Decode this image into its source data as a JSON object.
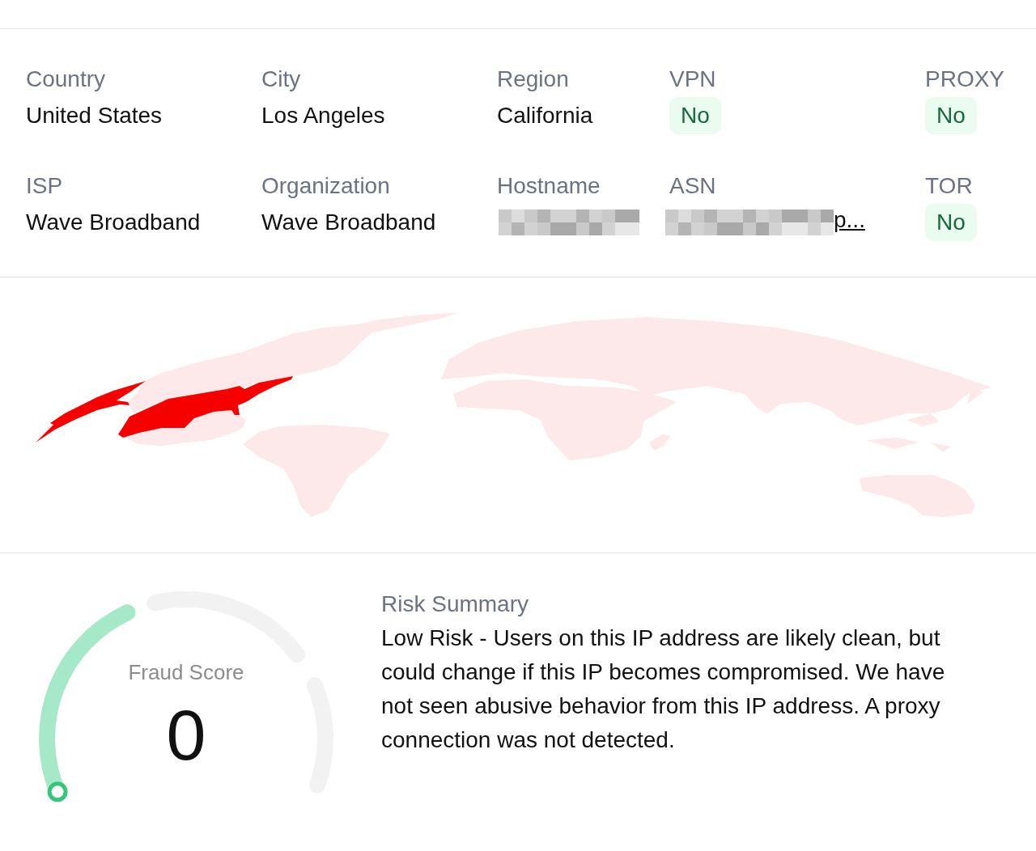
{
  "fields": [
    {
      "label": "Country",
      "kind": "text",
      "value": "United States"
    },
    {
      "label": "City",
      "kind": "text",
      "value": "Los Angeles"
    },
    {
      "label": "Region",
      "kind": "text",
      "value": "California"
    },
    {
      "label": "VPN",
      "kind": "badge",
      "value": "No"
    },
    {
      "label": "PROXY",
      "kind": "badge",
      "value": "No"
    },
    {
      "label": "ISP",
      "kind": "text",
      "value": "Wave Broadband"
    },
    {
      "label": "Organization",
      "kind": "text",
      "value": "Wave Broadband"
    },
    {
      "label": "Hostname",
      "kind": "masked"
    },
    {
      "label": "ASN",
      "kind": "masked_link",
      "value": "p..."
    },
    {
      "label": "TOR",
      "kind": "badge",
      "value": "No"
    }
  ],
  "fraud_score": {
    "label": "Fraud Score",
    "value": "0",
    "level": 0
  },
  "risk_summary": {
    "title": "Risk Summary",
    "text": "Low Risk - Users on this IP address are likely clean, but could change if this IP becomes compromised. We have not seen abusive behavior from this IP address. A proxy connection was not detected."
  }
}
